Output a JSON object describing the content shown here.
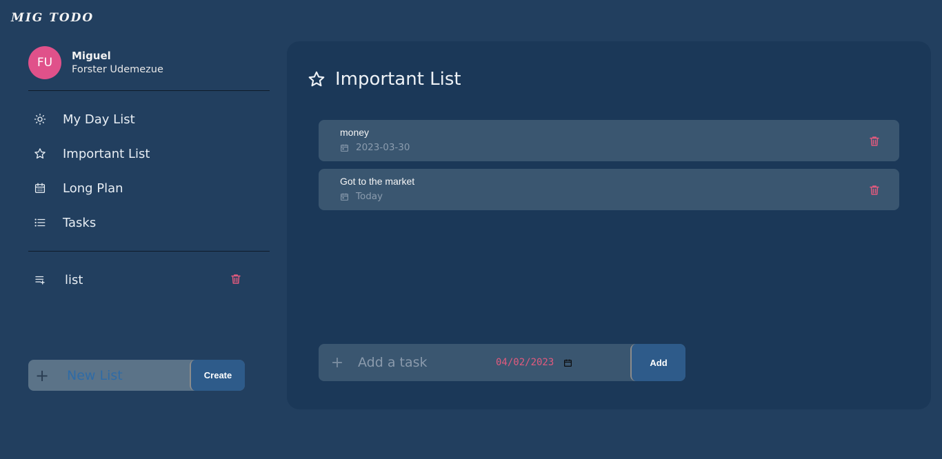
{
  "app": {
    "brand": "MIG TODO"
  },
  "user": {
    "initials": "FU",
    "first_name": "Miguel",
    "last_name": "Forster Udemezue"
  },
  "sidebar": {
    "items": [
      {
        "label": "My Day List",
        "icon": "sun-icon"
      },
      {
        "label": "Important List",
        "icon": "star-icon"
      },
      {
        "label": "Long Plan",
        "icon": "calendar-icon"
      },
      {
        "label": "Tasks",
        "icon": "list-icon"
      }
    ],
    "custom_lists": [
      {
        "label": "list",
        "icon": "playlist-add-icon"
      }
    ],
    "new_list": {
      "placeholder": "New List",
      "create_label": "Create"
    }
  },
  "main": {
    "title": "Important List",
    "tasks": [
      {
        "title": "money",
        "date": "2023-03-30"
      },
      {
        "title": "Got to the market",
        "date": "Today"
      }
    ],
    "add_task": {
      "placeholder": "Add a task",
      "date_value": "04/02/2023",
      "add_label": "Add"
    }
  },
  "colors": {
    "background": "#223f5f",
    "panel": "#1b3858",
    "card": "#3a5670",
    "accent_pink": "#e0518a",
    "button": "#2e5b8a",
    "trash": "#e25a7e"
  }
}
